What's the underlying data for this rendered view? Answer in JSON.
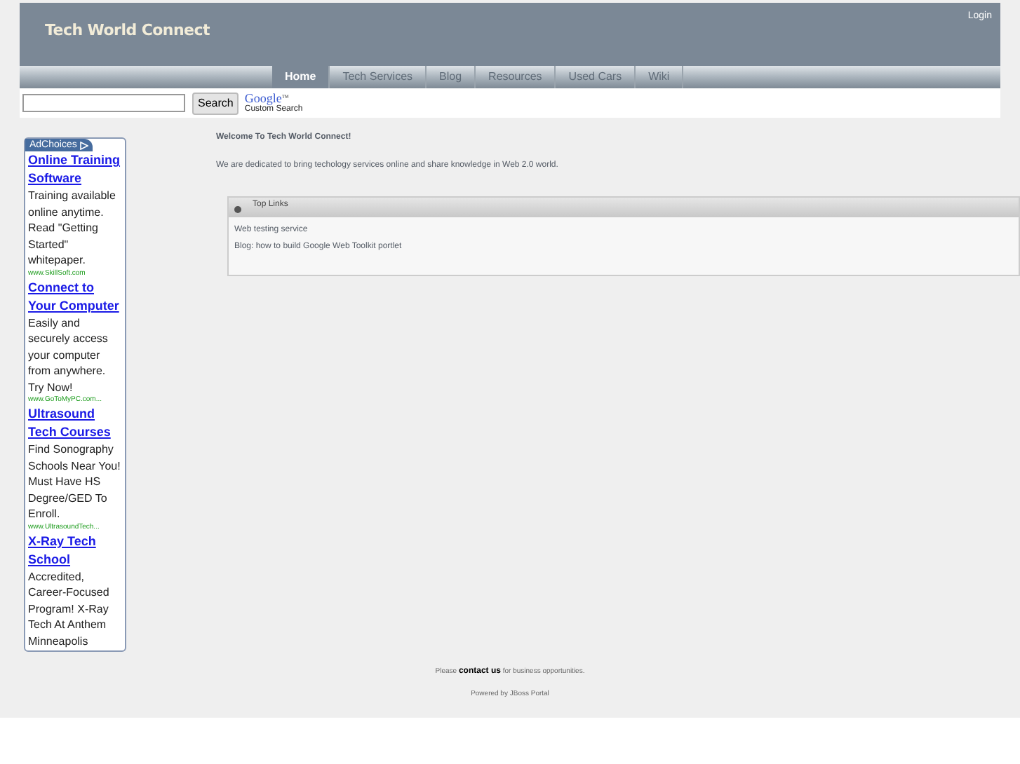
{
  "header": {
    "title": "Tech World Connect",
    "login": "Login"
  },
  "nav": [
    {
      "label": "Home",
      "selected": true
    },
    {
      "label": "Tech Services",
      "selected": false
    },
    {
      "label": "Blog",
      "selected": false
    },
    {
      "label": "Resources",
      "selected": false
    },
    {
      "label": "Used Cars",
      "selected": false
    },
    {
      "label": "Wiki",
      "selected": false
    }
  ],
  "search": {
    "button": "Search",
    "brand": "Google",
    "brand_mark": "™",
    "caption": "Custom Search"
  },
  "ads": {
    "label": "AdChoices",
    "items": [
      {
        "title": "Online Training Software",
        "body": "Training available online anytime. Read \"Getting Started\" whitepaper.",
        "url": "www.SkillSoft.com"
      },
      {
        "title": "Connect to Your Computer",
        "body": "Easily and securely access your computer from anywhere. Try Now!",
        "url": "www.GoToMyPC.com..."
      },
      {
        "title": "Ultrasound Tech Courses",
        "body": "Find Sonography Schools Near You! Must Have HS Degree/GED To Enroll.",
        "url": "www.UltrasoundTech..."
      },
      {
        "title": "X-Ray Tech School",
        "body": "Accredited, Career-Focused Program! X-Ray Tech At Anthem Minneapolis"
      }
    ]
  },
  "welcome": {
    "heading": "Welcome To Tech World Connect!",
    "text": "We are dedicated to bring techology services online and share knowledge in Web 2.0 world."
  },
  "top_links": {
    "title": "Top Links",
    "links": [
      "Web testing service",
      "Blog: how to build Google Web Toolkit portlet"
    ]
  },
  "footer": {
    "contact": "Please **contact us** for business opportunities.",
    "powered": "Powered by JBoss Portal"
  }
}
